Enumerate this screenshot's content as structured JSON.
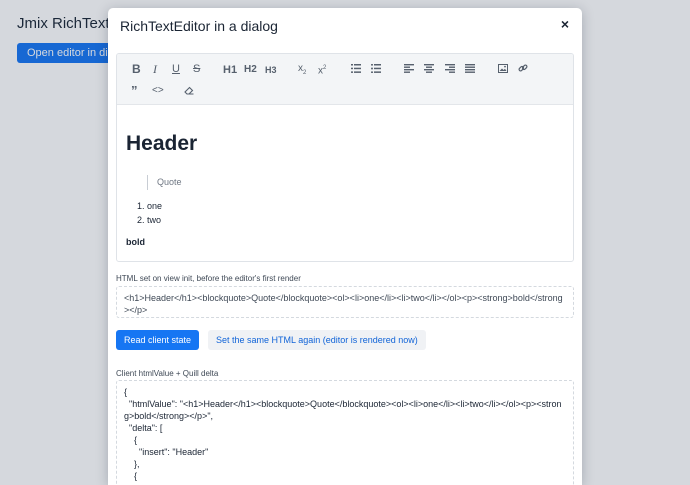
{
  "app": {
    "title": "Jmix RichTextEditor in a dialog",
    "open_button_label": "Open editor in dialog"
  },
  "dialog": {
    "title": "RichTextEditor in a dialog",
    "close_glyph": "×"
  },
  "toolbar": {
    "h1_label": "H1",
    "h2_label": "H2",
    "h3_label": "H3",
    "icons": [
      "bold-icon",
      "italic-icon",
      "underline-icon",
      "strikethrough-icon",
      "subscript-icon",
      "superscript-icon",
      "ordered-list-icon",
      "bullet-list-icon",
      "align-left-icon",
      "align-center-icon",
      "align-right-icon",
      "align-justify-icon",
      "image-icon",
      "link-icon",
      "blockquote-icon",
      "code-block-icon",
      "clear-format-icon"
    ]
  },
  "editor_content": {
    "heading": "Header",
    "quote": "Quote",
    "list_items": [
      "one",
      "two"
    ],
    "bold_text": "bold"
  },
  "html_field": {
    "label": "HTML set on view init, before the editor's first render",
    "value": "<h1>Header</h1><blockquote>Quote</blockquote><ol><li>one</li><li>two</li></ol><p><strong>bold</strong></p>"
  },
  "buttons": {
    "read_state": "Read client state",
    "set_again": "Set the same HTML again (editor is rendered now)"
  },
  "client_field": {
    "label": "Client htmlValue + Quill delta",
    "value": "{\n  \"htmlValue\": \"<h1>Header</h1><blockquote>Quote</blockquote><ol><li>one</li><li>two</li></ol><p><strong>bold</strong></p>\",\n  \"delta\": [\n    {\n      \"insert\": \"Header\"\n    },\n    {"
  },
  "colors": {
    "accent": "#1676f3",
    "secondary_text": "#1164d8"
  }
}
